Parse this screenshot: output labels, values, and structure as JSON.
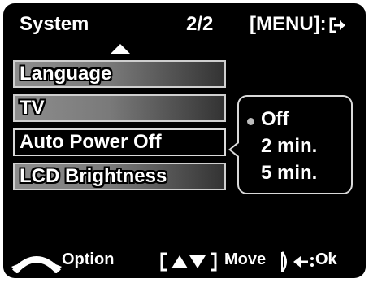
{
  "header": {
    "title": "System",
    "page_indicator": "2/2",
    "menu_hint": "[MENU]:",
    "exit_icon": "exit-arrow-icon"
  },
  "menu": {
    "items": [
      {
        "label": "Language"
      },
      {
        "label": "TV"
      },
      {
        "label": "Auto Power Off",
        "selected": true
      },
      {
        "label": "LCD Brightness"
      }
    ]
  },
  "popup": {
    "options": [
      {
        "label": "Off",
        "selected": true
      },
      {
        "label": "2 min."
      },
      {
        "label": "5 min."
      }
    ]
  },
  "footer": {
    "option_label": "Option",
    "move_label": "Move",
    "ok_label": "Ok",
    "icons": [
      "dial-icon",
      "up-down-arrows-icon",
      "right-button-icon",
      "back-arrow-icon"
    ]
  },
  "colors": {
    "background": "#000000",
    "text": "#ffffff",
    "item_gradient_start": "#8d8d8d",
    "item_gradient_end": "#333333",
    "border": "#cfcfcf"
  }
}
